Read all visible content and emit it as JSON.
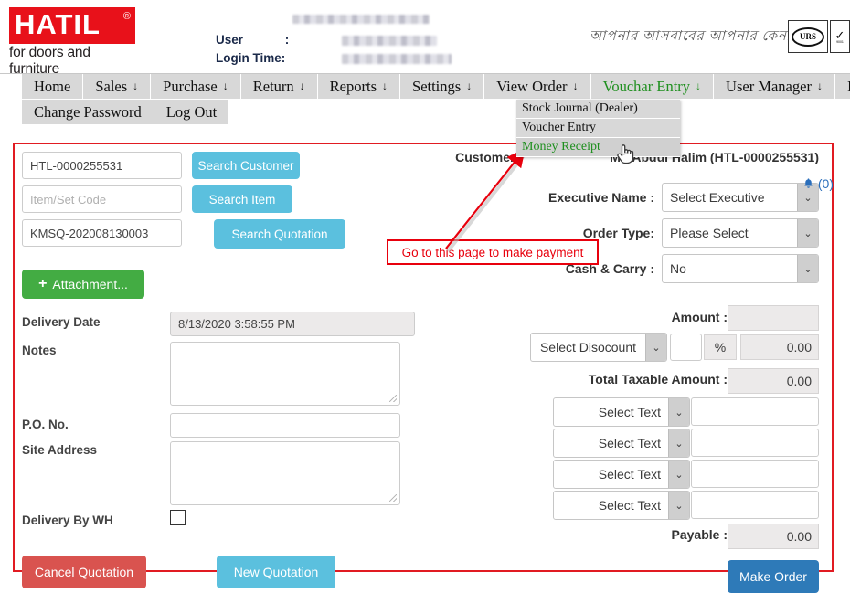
{
  "brand": {
    "name": "HATIL",
    "registered": "®",
    "tagline": "for doors and furniture",
    "bengali_tagline": "আপনার আসবাবের আপনার কেনা,",
    "cert1_text": "URS",
    "cert2_mark": "✓",
    "cert2_sub": "9001"
  },
  "header": {
    "user_label": "User",
    "user_colon": ":",
    "login_time_label": "Login Time:",
    "user_value": "",
    "login_time_value": ""
  },
  "nav": {
    "row1": [
      {
        "label": "Home",
        "caret": "",
        "active": false
      },
      {
        "label": "Sales",
        "caret": "↓",
        "active": false
      },
      {
        "label": "Purchase",
        "caret": "↓",
        "active": false
      },
      {
        "label": "Return",
        "caret": "↓",
        "active": false
      },
      {
        "label": "Reports",
        "caret": "↓",
        "active": false
      },
      {
        "label": "Settings",
        "caret": "↓",
        "active": false
      },
      {
        "label": "View Order",
        "caret": "↓",
        "active": false
      },
      {
        "label": "Vouchar Entry",
        "caret": "↓",
        "active": true
      },
      {
        "label": "User Manager",
        "caret": "↓",
        "active": false
      },
      {
        "label": "Inventory",
        "caret": "↓",
        "active": false
      }
    ],
    "row2": [
      {
        "label": "Change Password",
        "caret": "",
        "active": false
      },
      {
        "label": "Log Out",
        "caret": "",
        "active": false
      }
    ],
    "dropdown": [
      {
        "label": "Stock Journal (Dealer)",
        "highlight": false
      },
      {
        "label": "Voucher Entry",
        "highlight": false
      },
      {
        "label": "Money Receipt",
        "highlight": true
      }
    ],
    "notification": {
      "icon": "bell-icon",
      "glyph": "🔔",
      "count": "(0)"
    }
  },
  "search": {
    "customer_code": "HTL-0000255531",
    "customer_button": "Search Customer",
    "item_placeholder": "Item/Set Code",
    "item_value": "",
    "item_button": "Search Item",
    "quotation_code": "KMSQ-202008130003",
    "quotation_button": "Search Quotation"
  },
  "left_form": {
    "attachment_button": "Attachment...",
    "attachment_icon": "plus-icon",
    "delivery_date_label": "Delivery Date",
    "delivery_date_value": "8/13/2020 3:58:55 PM",
    "notes_label": "Notes",
    "notes_value": "",
    "po_label": "P.O. No.",
    "po_value": "",
    "site_address_label": "Site Address",
    "site_address_value": "",
    "delivery_by_wh_label": "Delivery By WH",
    "delivery_by_wh_checked": false,
    "cancel_button": "Cancel Quotation",
    "new_button": "New Quotation"
  },
  "right_form": {
    "customer_label": "Customer :",
    "customer_value": "Md.Abdul Halim (HTL-0000255531)",
    "executive_label": "Executive Name :",
    "executive_value": "Select Executive",
    "order_type_label": "Order Type:",
    "order_type_value": "Please Select",
    "cash_carry_label": "Cash & Carry :",
    "cash_carry_value": "No",
    "amount_label": "Amount :",
    "amount_value": "",
    "discount_select": "Select Disocount",
    "discount_input": "",
    "percent_symbol": "%",
    "discount_amount": "0.00",
    "total_taxable_label": "Total Taxable Amount :",
    "total_taxable_value": "0.00",
    "text_rows": [
      {
        "select": "Select Text",
        "value": ""
      },
      {
        "select": "Select Text",
        "value": ""
      },
      {
        "select": "Select Text",
        "value": ""
      },
      {
        "select": "Select Text",
        "value": ""
      }
    ],
    "payable_label": "Payable :",
    "payable_value": "0.00",
    "make_order_button": "Make Order"
  },
  "annotation": {
    "callout_text": "Go to this page to make payment",
    "color": "#e8000d"
  },
  "colors": {
    "brand_red": "#e8111a",
    "panel_border": "#e11b22",
    "cyan": "#5bc0de",
    "green": "#43ac43",
    "red": "#d9534f",
    "blue": "#2e7ab8",
    "nav_bg": "#d8d8d8",
    "active_green": "#1e8f1e"
  }
}
